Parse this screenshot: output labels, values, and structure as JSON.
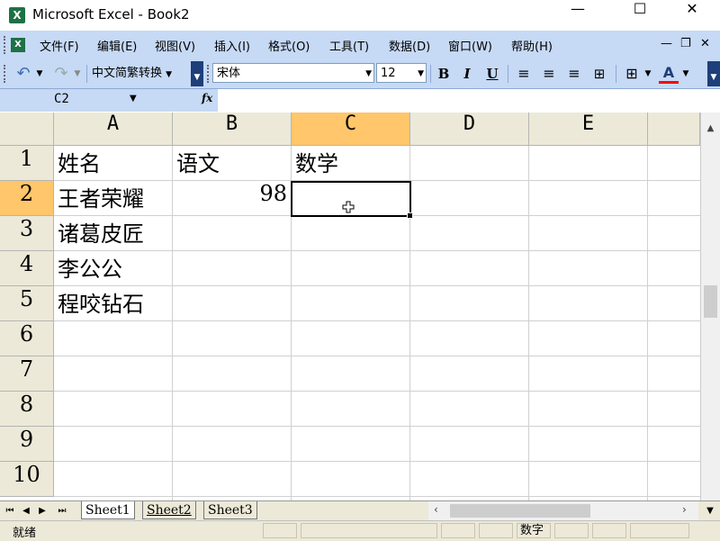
{
  "window": {
    "title": "Microsoft Excel - Book2",
    "minimize": "—",
    "maximize": "☐",
    "close": "✕",
    "app_icon_label": "X"
  },
  "menu": {
    "items": [
      "文件(F)",
      "编辑(E)",
      "视图(V)",
      "插入(I)",
      "格式(O)",
      "工具(T)",
      "数据(D)",
      "窗口(W)",
      "帮助(H)"
    ],
    "doc_min": "—",
    "doc_restore": "❐",
    "doc_close": "✕"
  },
  "toolbar": {
    "convert_label": "中文简繁转换",
    "font_name": "宋体",
    "font_size": "12",
    "bold": "B",
    "italic": "I",
    "underline": "U",
    "font_color_label": "A",
    "font_color": "#ff0000"
  },
  "formula_bar": {
    "name_box": "C2",
    "fx": "fx",
    "content": ""
  },
  "grid": {
    "columns": [
      "A",
      "B",
      "C",
      "D",
      "E"
    ],
    "rows": [
      "1",
      "2",
      "3",
      "4",
      "5",
      "6",
      "7",
      "8",
      "9",
      "10"
    ],
    "active_cell": "C2",
    "cells": {
      "A1": "姓名",
      "B1": "语文",
      "C1": "数学",
      "A2": "王者荣耀",
      "B2": "98",
      "A3": "诸葛皮匠",
      "A4": "李公公",
      "A5": "程咬钻石"
    }
  },
  "sheets": {
    "tabs": [
      "Sheet1",
      "Sheet2",
      "Sheet3"
    ],
    "active": "Sheet1"
  },
  "status": {
    "ready": "就绪",
    "num_mode": "数字"
  },
  "colors": {
    "chrome": "#c6d9f5",
    "header": "#ece9d8",
    "active_header": "#ffc66b"
  }
}
